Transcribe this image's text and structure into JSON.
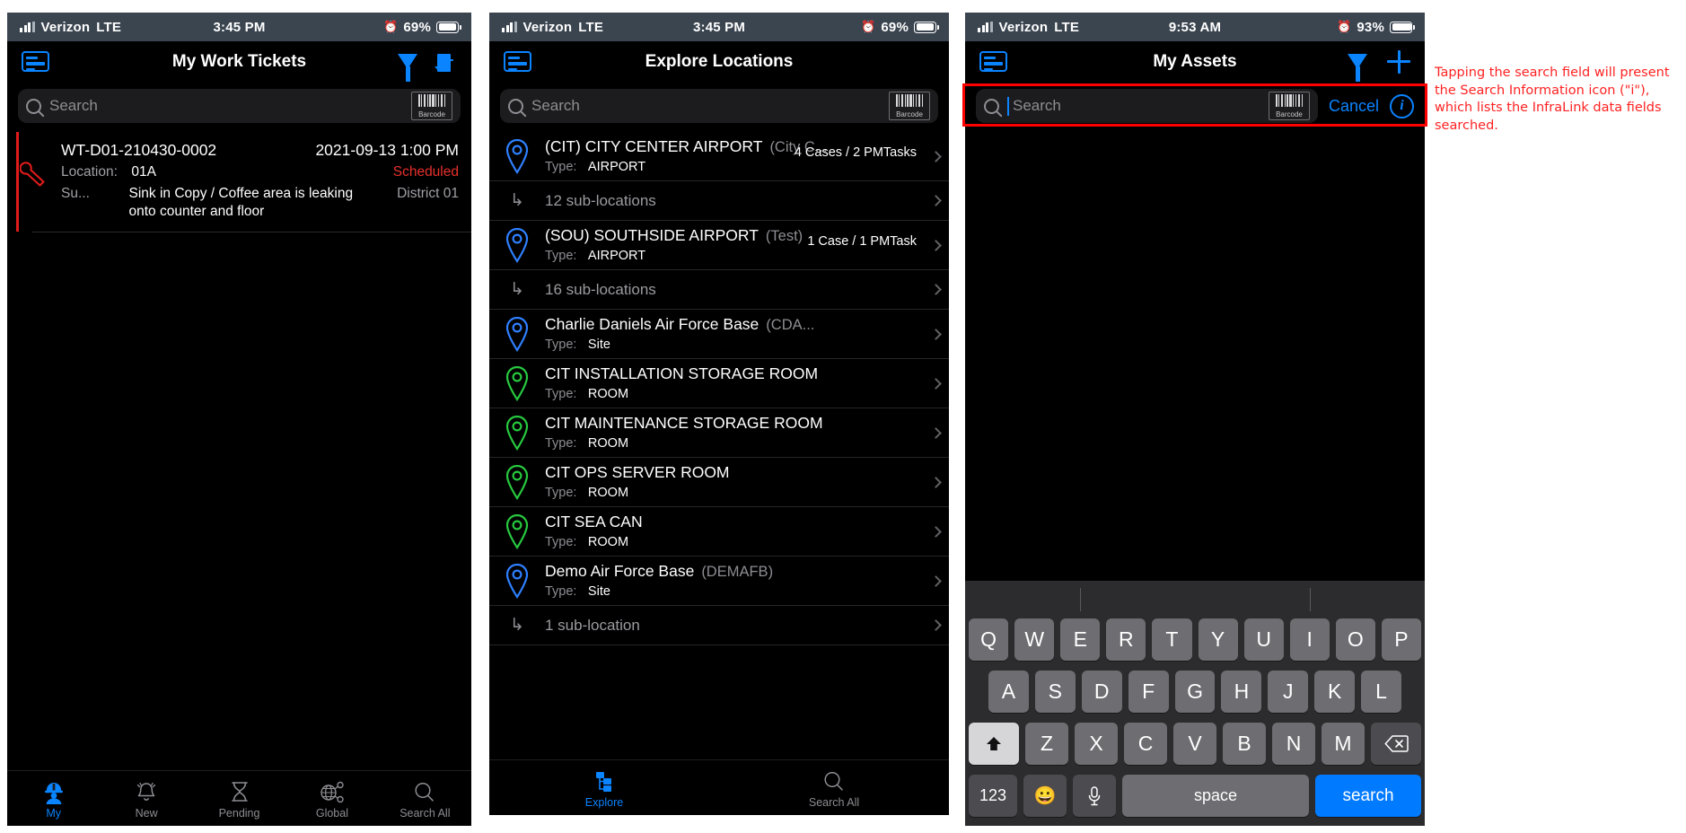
{
  "annotation": {
    "text": "Tapping the search field will present the Search Information icon (\"i\"), which lists the InfraLink data fields searched.",
    "color": "#ff0000"
  },
  "colors": {
    "accent_blue": "#0a84ff",
    "status_red": "#e8302a",
    "pin_blue": "#2f80ff",
    "pin_green": "#27c93f",
    "keyboard_search": "#007aff"
  },
  "phone1": {
    "status": {
      "carrier": "Verizon",
      "network": "LTE",
      "time": "3:45 PM",
      "battery": "69%",
      "alarm_icon": "alarm-clock-icon"
    },
    "nav": {
      "menu_icon": "card-menu-icon",
      "title": "My Work Tickets",
      "filter_icon": "filter-funnel-icon",
      "sort_icon": "sort-descending-icon"
    },
    "search": {
      "placeholder": "Search",
      "search_icon": "magnifier-icon",
      "barcode_label": "Barcode"
    },
    "tickets": [
      {
        "id": "WT-D01-210430-0002",
        "date": "2021-09-13 1:00 PM",
        "location_key": "Location:",
        "location_value": "01A",
        "status": "Scheduled",
        "summary_key": "Su...",
        "summary_value": "Sink in Copy / Coffee area is leaking onto counter and floor",
        "district": "District 01",
        "icon": "wrench-icon"
      }
    ],
    "tabs": [
      {
        "label": "My",
        "icon": "worker-helmet-icon",
        "active": true
      },
      {
        "label": "New",
        "icon": "bell-icon",
        "active": false
      },
      {
        "label": "Pending",
        "icon": "hourglass-icon",
        "active": false
      },
      {
        "label": "Global",
        "icon": "globe-share-icon",
        "active": false
      },
      {
        "label": "Search All",
        "icon": "magnifier-icon",
        "active": false
      }
    ]
  },
  "phone2": {
    "status": {
      "carrier": "Verizon",
      "network": "LTE",
      "time": "3:45 PM",
      "battery": "69%",
      "alarm_icon": "alarm-clock-icon"
    },
    "nav": {
      "menu_icon": "card-menu-icon",
      "title": "Explore Locations"
    },
    "search": {
      "placeholder": "Search",
      "search_icon": "magnifier-icon",
      "barcode_label": "Barcode"
    },
    "locations": [
      {
        "kind": "location",
        "name": "(CIT) CITY CENTER AIRPORT",
        "code": "(City C...",
        "type_key": "Type:",
        "type_value": "AIRPORT",
        "counts": "4 Cases / 2 PMTasks",
        "pin": "pin-blue-icon"
      },
      {
        "kind": "sub",
        "label": "12 sub-locations"
      },
      {
        "kind": "location",
        "name": "(SOU) SOUTHSIDE AIRPORT",
        "code": "(Test)",
        "type_key": "Type:",
        "type_value": "AIRPORT",
        "counts": "1 Case / 1 PMTask",
        "pin": "pin-blue-icon"
      },
      {
        "kind": "sub",
        "label": "16 sub-locations"
      },
      {
        "kind": "location",
        "name": "Charlie Daniels Air Force Base",
        "code": "(CDA...",
        "type_key": "Type:",
        "type_value": "Site",
        "counts": "",
        "pin": "pin-blue-icon"
      },
      {
        "kind": "location",
        "name": "CIT INSTALLATION STORAGE ROOM",
        "code": "",
        "type_key": "Type:",
        "type_value": "ROOM",
        "counts": "",
        "pin": "pin-green-icon"
      },
      {
        "kind": "location",
        "name": "CIT MAINTENANCE STORAGE ROOM",
        "code": "",
        "type_key": "Type:",
        "type_value": "ROOM",
        "counts": "",
        "pin": "pin-green-icon"
      },
      {
        "kind": "location",
        "name": "CIT OPS SERVER ROOM",
        "code": "",
        "type_key": "Type:",
        "type_value": "ROOM",
        "counts": "",
        "pin": "pin-green-icon"
      },
      {
        "kind": "location",
        "name": "CIT SEA CAN",
        "code": "",
        "type_key": "Type:",
        "type_value": "ROOM",
        "counts": "",
        "pin": "pin-green-icon"
      },
      {
        "kind": "location",
        "name": "Demo Air Force Base",
        "code": "(DEMAFB)",
        "type_key": "Type:",
        "type_value": "Site",
        "counts": "",
        "pin": "pin-blue-icon"
      },
      {
        "kind": "sub",
        "label": "1 sub-location"
      }
    ],
    "tabs": [
      {
        "label": "Explore",
        "icon": "hierarchy-icon",
        "active": true
      },
      {
        "label": "Search All",
        "icon": "magnifier-icon",
        "active": false
      }
    ]
  },
  "phone3": {
    "status": {
      "carrier": "Verizon",
      "network": "LTE",
      "time": "9:53 AM",
      "battery": "93%",
      "alarm_icon": "alarm-clock-icon"
    },
    "nav": {
      "menu_icon": "card-menu-icon",
      "title": "My Assets",
      "filter_icon": "filter-funnel-icon",
      "add_icon": "plus-icon"
    },
    "search": {
      "placeholder": "Search",
      "value": "",
      "search_icon": "magnifier-icon",
      "barcode_label": "Barcode",
      "cancel_label": "Cancel",
      "info_icon": "info-circle-icon",
      "info_glyph": "i"
    },
    "keyboard": {
      "row1": [
        "Q",
        "W",
        "E",
        "R",
        "T",
        "Y",
        "U",
        "I",
        "O",
        "P"
      ],
      "row2": [
        "A",
        "S",
        "D",
        "F",
        "G",
        "H",
        "J",
        "K",
        "L"
      ],
      "row3": [
        "Z",
        "X",
        "C",
        "V",
        "B",
        "N",
        "M"
      ],
      "shift_icon": "shift-arrow-icon",
      "backspace_icon": "backspace-icon",
      "numbers_label": "123",
      "emoji_icon": "emoji-smiley-icon",
      "mic_icon": "microphone-icon",
      "space_label": "space",
      "search_label": "search"
    }
  }
}
